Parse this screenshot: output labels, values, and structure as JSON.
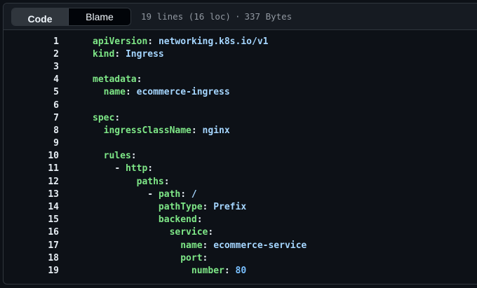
{
  "header": {
    "code_label": "Code",
    "blame_label": "Blame",
    "lines_info": "19 lines (16 loc)",
    "separator": "·",
    "size_info": "337 Bytes"
  },
  "lines": [
    {
      "n": "1",
      "indent": "",
      "dash": "",
      "key": "apiVersion",
      "value": "networking.k8s.io/v1",
      "vtype": "val"
    },
    {
      "n": "2",
      "indent": "",
      "dash": "",
      "key": "kind",
      "value": "Ingress",
      "vtype": "val"
    },
    {
      "n": "3",
      "indent": "",
      "dash": "",
      "key": "",
      "value": "",
      "vtype": "val"
    },
    {
      "n": "4",
      "indent": "",
      "dash": "",
      "key": "metadata",
      "value": "",
      "vtype": "val"
    },
    {
      "n": "5",
      "indent": "  ",
      "dash": "",
      "key": "name",
      "value": "ecommerce-ingress",
      "vtype": "val"
    },
    {
      "n": "6",
      "indent": "",
      "dash": "",
      "key": "",
      "value": "",
      "vtype": "val"
    },
    {
      "n": "7",
      "indent": "",
      "dash": "",
      "key": "spec",
      "value": "",
      "vtype": "val"
    },
    {
      "n": "8",
      "indent": "  ",
      "dash": "",
      "key": "ingressClassName",
      "value": "nginx",
      "vtype": "val"
    },
    {
      "n": "9",
      "indent": "",
      "dash": "",
      "key": "",
      "value": "",
      "vtype": "val"
    },
    {
      "n": "10",
      "indent": "  ",
      "dash": "",
      "key": "rules",
      "value": "",
      "vtype": "val"
    },
    {
      "n": "11",
      "indent": "    ",
      "dash": "- ",
      "key": "http",
      "value": "",
      "vtype": "val"
    },
    {
      "n": "12",
      "indent": "        ",
      "dash": "",
      "key": "paths",
      "value": "",
      "vtype": "val"
    },
    {
      "n": "13",
      "indent": "          ",
      "dash": "- ",
      "key": "path",
      "value": "/",
      "vtype": "val"
    },
    {
      "n": "14",
      "indent": "            ",
      "dash": "",
      "key": "pathType",
      "value": "Prefix",
      "vtype": "val"
    },
    {
      "n": "15",
      "indent": "            ",
      "dash": "",
      "key": "backend",
      "value": "",
      "vtype": "val"
    },
    {
      "n": "16",
      "indent": "              ",
      "dash": "",
      "key": "service",
      "value": "",
      "vtype": "val"
    },
    {
      "n": "17",
      "indent": "                ",
      "dash": "",
      "key": "name",
      "value": "ecommerce-service",
      "vtype": "val"
    },
    {
      "n": "18",
      "indent": "                ",
      "dash": "",
      "key": "port",
      "value": "",
      "vtype": "val"
    },
    {
      "n": "19",
      "indent": "                  ",
      "dash": "",
      "key": "number",
      "value": "80",
      "vtype": "num"
    }
  ]
}
